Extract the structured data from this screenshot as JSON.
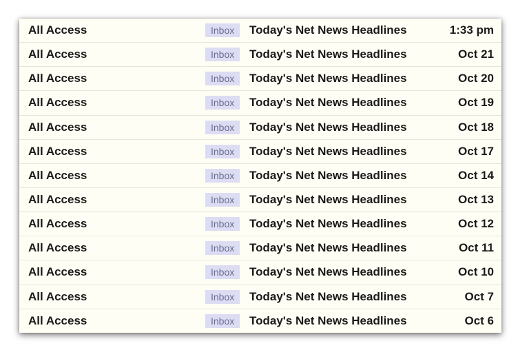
{
  "messages": [
    {
      "sender": "All Access",
      "label": "Inbox",
      "subject": "Today's Net News Headlines",
      "date": "1:33 pm"
    },
    {
      "sender": "All Access",
      "label": "Inbox",
      "subject": "Today's Net News Headlines",
      "date": "Oct 21"
    },
    {
      "sender": "All Access",
      "label": "Inbox",
      "subject": "Today's Net News Headlines",
      "date": "Oct 20"
    },
    {
      "sender": "All Access",
      "label": "Inbox",
      "subject": "Today's Net News Headlines",
      "date": "Oct 19"
    },
    {
      "sender": "All Access",
      "label": "Inbox",
      "subject": "Today's Net News Headlines",
      "date": "Oct 18"
    },
    {
      "sender": "All Access",
      "label": "Inbox",
      "subject": "Today's Net News Headlines",
      "date": "Oct 17"
    },
    {
      "sender": "All Access",
      "label": "Inbox",
      "subject": "Today's Net News Headlines",
      "date": "Oct 14"
    },
    {
      "sender": "All Access",
      "label": "Inbox",
      "subject": "Today's Net News Headlines",
      "date": "Oct 13"
    },
    {
      "sender": "All Access",
      "label": "Inbox",
      "subject": "Today's Net News Headlines",
      "date": "Oct 12"
    },
    {
      "sender": "All Access",
      "label": "Inbox",
      "subject": "Today's Net News Headlines",
      "date": "Oct 11"
    },
    {
      "sender": "All Access",
      "label": "Inbox",
      "subject": "Today's Net News Headlines",
      "date": "Oct 10"
    },
    {
      "sender": "All Access",
      "label": "Inbox",
      "subject": "Today's Net News Headlines",
      "date": "Oct 7"
    },
    {
      "sender": "All Access",
      "label": "Inbox",
      "subject": "Today's Net News Headlines",
      "date": "Oct 6"
    }
  ],
  "colors": {
    "row_background": "#fffef5",
    "label_background": "#dcdcf3",
    "label_text": "#6b6b95"
  }
}
